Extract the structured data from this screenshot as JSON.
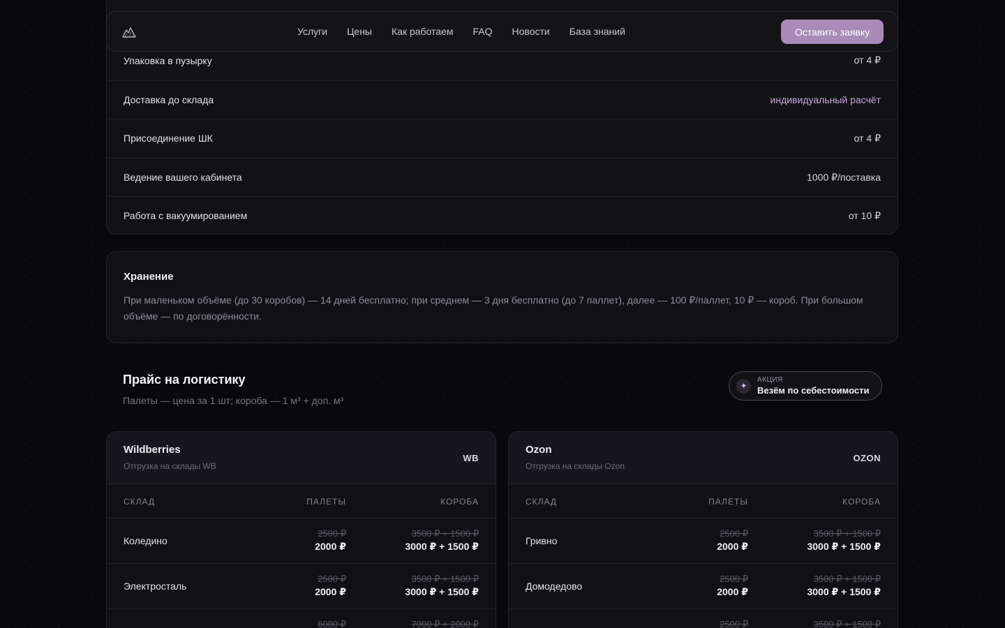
{
  "nav": {
    "links": [
      "Услуги",
      "Цены",
      "Как работаем",
      "FAQ",
      "Новости",
      "База знаний"
    ],
    "cta": "Оставить заявку"
  },
  "services": [
    {
      "name": "Упаковка в пузырку",
      "price": "от 4 ₽"
    },
    {
      "name": "Доставка до склада",
      "price": "индивидуальный расчёт"
    },
    {
      "name": "Присоединение ШК",
      "price": "от 4 ₽"
    },
    {
      "name": "Ведение вашего кабинета",
      "price": "1000 ₽/поставка"
    },
    {
      "name": "Работа с вакуумированием",
      "price": "от 10 ₽"
    }
  ],
  "storage": {
    "title": "Хранение",
    "text": "При маленьком объёме (до 30 коробов) — 14 дней бесплатно; при среднем — 3 дня бесплатно (до 7 паллет), далее — 100 ₽/паллет, 10 ₽ — короб. При большом объёме — по договорённости."
  },
  "logistics": {
    "title": "Прайс на логистику",
    "subtitle": "Палеты — цена за 1 шт; короба — 1 м³ + доп. м³",
    "promo_kicker": "АКЦИЯ",
    "promo_text": "Везём по себестоимости"
  },
  "columns": {
    "warehouse": "СКЛАД",
    "pallets": "ПАЛЕТЫ",
    "boxes": "КОРОБА"
  },
  "wb": {
    "name": "Wildberries",
    "sub": "Отгрузка на склады WB",
    "code": "WB",
    "rows": [
      {
        "warehouse": "Коледино",
        "pal_old": "2500 ₽",
        "pal_new": "2000 ₽",
        "box_old": "3500 ₽ + 1500 ₽",
        "box_new": "3000 ₽ + 1500 ₽"
      },
      {
        "warehouse": "Электросталь",
        "pal_old": "2500 ₽",
        "pal_new": "2000 ₽",
        "box_old": "3500 ₽ + 1500 ₽",
        "box_new": "3000 ₽ + 1500 ₽"
      },
      {
        "warehouse": "",
        "pal_old": "6000 ₽",
        "pal_new": "",
        "box_old": "7000 ₽ + 2000 ₽",
        "box_new": ""
      }
    ]
  },
  "ozon": {
    "name": "Ozon",
    "sub": "Отгрузка на склады Ozon",
    "code": "OZON",
    "rows": [
      {
        "warehouse": "Гривно",
        "pal_old": "2500 ₽",
        "pal_new": "2000 ₽",
        "box_old": "3500 ₽ + 1500 ₽",
        "box_new": "3000 ₽ + 1500 ₽"
      },
      {
        "warehouse": "Домодедово",
        "pal_old": "2500 ₽",
        "pal_new": "2000 ₽",
        "box_old": "3500 ₽ + 1500 ₽",
        "box_new": "3000 ₽ + 1500 ₽"
      },
      {
        "warehouse": "",
        "pal_old": "2500 ₽",
        "pal_new": "",
        "box_old": "3500 ₽ + 1500 ₽",
        "box_new": ""
      }
    ]
  }
}
